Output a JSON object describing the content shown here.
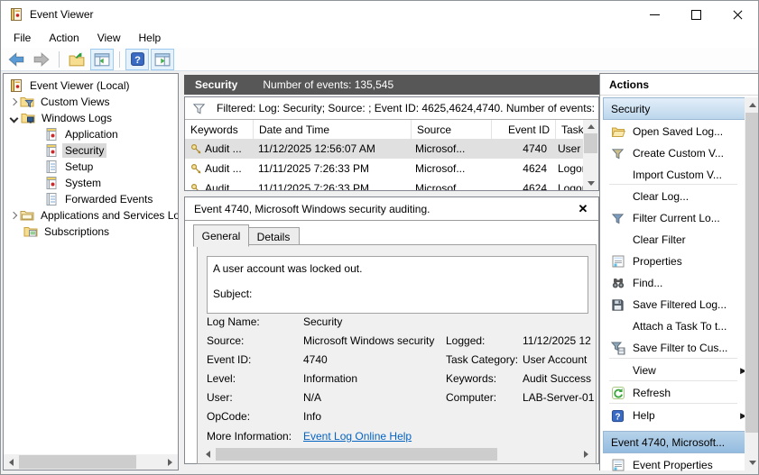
{
  "window": {
    "title": "Event Viewer"
  },
  "menu": {
    "items": [
      "File",
      "Action",
      "View",
      "Help"
    ]
  },
  "toolbar": {
    "icons": [
      "back-icon",
      "forward-icon",
      "export-log-icon",
      "console-tree-toggle-icon",
      "help-icon",
      "action-pane-toggle-icon"
    ]
  },
  "tree": {
    "items": [
      {
        "label": "Event Viewer (Local)",
        "icon": "event-viewer-icon"
      },
      {
        "label": "Custom Views",
        "icon": "custom-views-folder-icon",
        "state": "collapsed"
      },
      {
        "label": "Windows Logs",
        "icon": "windows-logs-folder-icon",
        "state": "expanded"
      },
      {
        "label": "Application",
        "icon": "event-log-icon"
      },
      {
        "label": "Security",
        "icon": "event-log-icon",
        "selected": true
      },
      {
        "label": "Setup",
        "icon": "plain-log-icon"
      },
      {
        "label": "System",
        "icon": "event-log-icon"
      },
      {
        "label": "Forwarded Events",
        "icon": "plain-log-icon"
      },
      {
        "label": "Applications and Services Lo",
        "icon": "services-folder-icon",
        "state": "collapsed"
      },
      {
        "label": "Subscriptions",
        "icon": "subscriptions-icon"
      }
    ]
  },
  "log_panel": {
    "title": "Security",
    "subtitle": "Number of events: 135,545",
    "filter_text": "Filtered: Log: Security; Source: ; Event ID: 4625,4624,4740. Number of events:",
    "columns": [
      "Keywords",
      "Date and Time",
      "Source",
      "Event ID",
      "Task Cate..."
    ],
    "rows": [
      {
        "keywords": "Audit ...",
        "date": "11/12/2025 12:56:07 AM",
        "source": "Microsof...",
        "event_id": "4740",
        "task": "User Acc...",
        "selected": true
      },
      {
        "keywords": "Audit ...",
        "date": "11/11/2025 7:26:33 PM",
        "source": "Microsof...",
        "event_id": "4624",
        "task": "Logon",
        "selected": false
      },
      {
        "keywords": "Audit ...",
        "date": "11/11/2025 7:26:33 PM",
        "source": "Microsof...",
        "event_id": "4624",
        "task": "Logon",
        "selected": false
      }
    ]
  },
  "detail_panel": {
    "title": "Event 4740, Microsoft Windows security auditing.",
    "tabs": [
      "General",
      "Details"
    ],
    "active_tab": "General",
    "description": [
      "A user account was locked out.",
      "Subject:"
    ],
    "field_rows": [
      {
        "l_label": "Log Name:",
        "l_value": "Security",
        "r_label": "",
        "r_value": ""
      },
      {
        "l_label": "Source:",
        "l_value": "Microsoft Windows security",
        "r_label": "Logged:",
        "r_value": "11/12/2025 12"
      },
      {
        "l_label": "Event ID:",
        "l_value": "4740",
        "r_label": "Task Category:",
        "r_value": "User Account"
      },
      {
        "l_label": "Level:",
        "l_value": "Information",
        "r_label": "Keywords:",
        "r_value": "Audit Success"
      },
      {
        "l_label": "User:",
        "l_value": "N/A",
        "r_label": "Computer:",
        "r_value": "LAB-Server-01"
      },
      {
        "l_label": "OpCode:",
        "l_value": "Info",
        "r_label": "",
        "r_value": ""
      }
    ],
    "more_info_label": "More Information:",
    "more_info_link": "Event Log Online Help"
  },
  "actions_panel": {
    "title": "Actions",
    "sections": [
      {
        "header": "Security",
        "items": [
          {
            "label": "Open Saved Log...",
            "icon": "open-saved-log-icon"
          },
          {
            "label": "Create Custom V...",
            "icon": "create-custom-view-icon"
          },
          {
            "label": "Import Custom V...",
            "icon": ""
          },
          {
            "label": "Clear Log...",
            "icon": ""
          },
          {
            "label": "Filter Current Lo...",
            "icon": "filter-icon"
          },
          {
            "label": "Clear Filter",
            "icon": ""
          },
          {
            "label": "Properties",
            "icon": "properties-icon"
          },
          {
            "label": "Find...",
            "icon": "find-icon"
          },
          {
            "label": "Save Filtered Log...",
            "icon": "save-icon"
          },
          {
            "label": "Attach a Task To t...",
            "icon": ""
          },
          {
            "label": "Save Filter to Cus...",
            "icon": "save-filter-icon"
          },
          {
            "label": "View",
            "icon": "",
            "submenu": true
          },
          {
            "label": "Refresh",
            "icon": "refresh-icon"
          },
          {
            "label": "Help",
            "icon": "help-icon",
            "submenu": true
          }
        ]
      },
      {
        "header": "Event 4740, Microsoft...",
        "items": [
          {
            "label": "Event Properties",
            "icon": "properties-icon"
          }
        ]
      }
    ]
  },
  "glyphs": {
    "collapse": "▲",
    "submenu": "▶",
    "close": "✕"
  },
  "colors": {
    "log_header_bg": "#575757",
    "selection": "#e0e0e0",
    "link": "#0563c1",
    "section_header": "#bcd6ec",
    "active_section_header": "#94bcdf"
  }
}
